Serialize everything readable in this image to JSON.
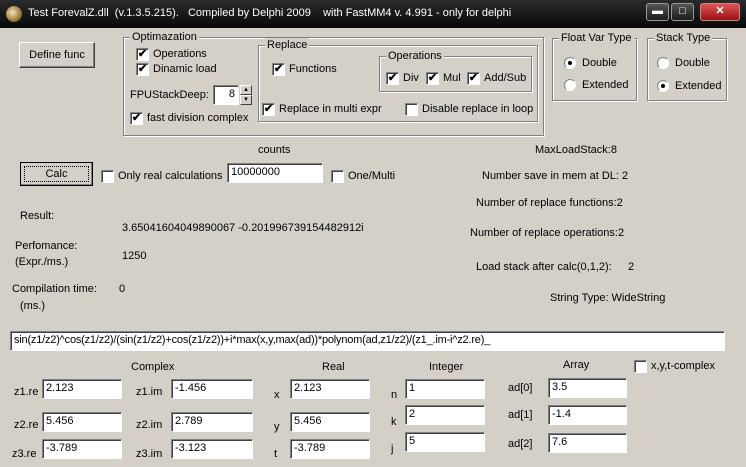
{
  "window": {
    "title": "Test ForevalZ.dll  (v.1.3.5.215).   Compiled by Delphi 2009    with FastMM4 v. 4.991 - only for delphi"
  },
  "define_button": "Define func",
  "optimazation": {
    "title": "Optimazation",
    "operations": {
      "label": "Operations",
      "checked": true
    },
    "dinamic_load": {
      "label": "Dinamic load",
      "checked": true
    },
    "fpu_label": "FPUStackDeep:",
    "fpu_value": "8",
    "fast_division": {
      "label": "fast division complex",
      "checked": true
    }
  },
  "replace": {
    "title": "Replace",
    "functions": {
      "label": "Functions",
      "checked": true
    },
    "multi_expr": {
      "label": "Replace in multi expr",
      "checked": true
    },
    "disable_loop": {
      "label": "Disable replace in loop",
      "checked": false
    },
    "operations_title": "Operations",
    "div": {
      "label": "Div",
      "checked": true
    },
    "mul": {
      "label": "Mul",
      "checked": true
    },
    "addsub": {
      "label": "Add/Sub",
      "checked": true
    }
  },
  "float_var_type": {
    "title": "Float Var Type",
    "double": "Double",
    "extended": "Extended",
    "selected": "double"
  },
  "stack_type": {
    "title": "Stack Type",
    "double": "Double",
    "extended": "Extended",
    "selected": "extended"
  },
  "calc_button": "Calc",
  "only_real": {
    "label": "Only real calculations",
    "checked": false
  },
  "counts": {
    "label": "counts",
    "value": "10000000"
  },
  "one_multi": {
    "label": "One/Multi",
    "checked": false
  },
  "result": {
    "label": "Result:",
    "value": "3.65041604049890067  -0.201996739154482912i"
  },
  "performance": {
    "label1": "Perfomance:",
    "label2": "(Expr./ms.)",
    "value": "1250"
  },
  "compilation": {
    "label": "Compilation time:",
    "value": "0",
    "unit": "(ms.)"
  },
  "stats": {
    "max_load_stack": "MaxLoadStack:8",
    "number_save": "Number save in mem at DL:  2",
    "replace_functions": "Number of replace functions:2",
    "replace_operations": "Number of replace operations:2",
    "load_stack_after": "Load stack after calc(0,1,2):",
    "load_stack_value": "2",
    "string_type": "String Type:  WideString"
  },
  "expression": "sin(z1/z2)^cos(z1/z2)/(sin(z1/z2)+cos(z1/z2))+i*max(x,y,max(ad))*polynom(ad,z1/z2)/(z1_.im-i^z2.re)_",
  "headers": {
    "complex": "Complex",
    "real": "Real",
    "integer": "Integer",
    "array": "Array"
  },
  "xyt_complex": {
    "label": "x,y,t-complex",
    "checked": false
  },
  "complex_rows": [
    {
      "re_label": "z1.re",
      "re_value": "2.123",
      "im_label": "z1.im",
      "im_value": "-1.456"
    },
    {
      "re_label": "z2.re",
      "re_value": "5.456",
      "im_label": "z2.im",
      "im_value": "2.789"
    },
    {
      "re_label": "z3.re",
      "re_value": "-3.789",
      "im_label": "z3.im",
      "im_value": "-3.123"
    }
  ],
  "real_rows": [
    {
      "label": "x",
      "value": "2.123"
    },
    {
      "label": "y",
      "value": "5.456"
    },
    {
      "label": "t",
      "value": "-3.789"
    }
  ],
  "integer_rows": [
    {
      "label": "n",
      "value": "1"
    },
    {
      "label": "k",
      "value": "2"
    },
    {
      "label": "j",
      "value": "5"
    }
  ],
  "array_rows": [
    {
      "label": "ad[0]",
      "value": "3.5"
    },
    {
      "label": "ad[1]",
      "value": "-1.4"
    },
    {
      "label": "ad[2]",
      "value": "7.6"
    }
  ]
}
